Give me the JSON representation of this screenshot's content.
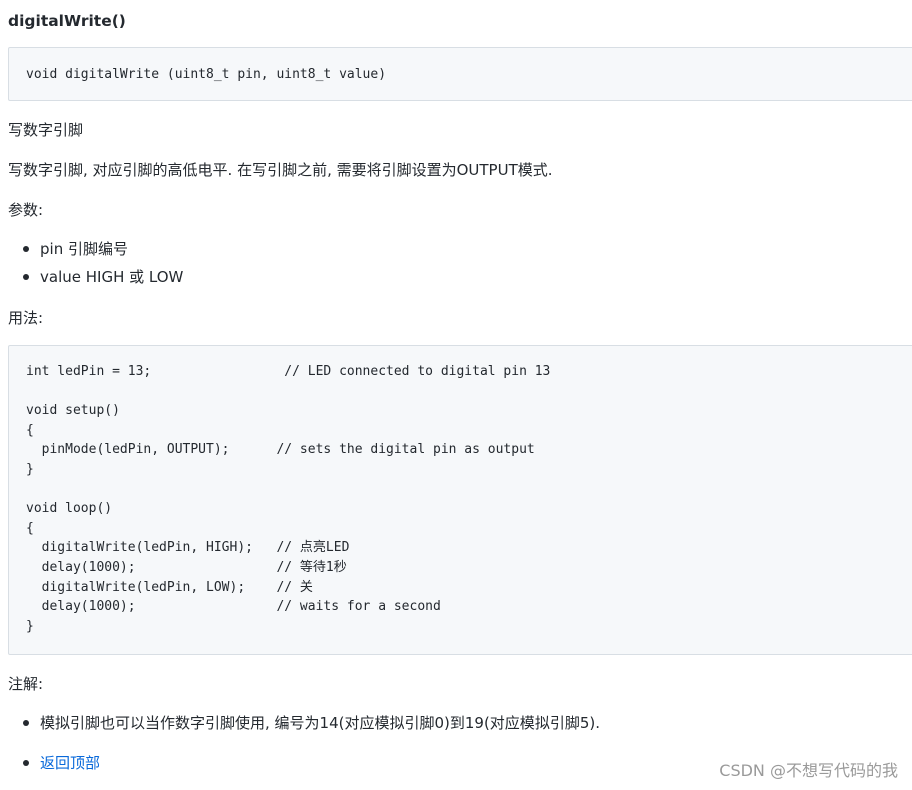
{
  "doc": {
    "title": "digitalWrite()",
    "signature_code": "void digitalWrite (uint8_t pin, uint8_t value)",
    "summary": "写数字引脚",
    "description": "写数字引脚, 对应引脚的高低电平. 在写引脚之前, 需要将引脚设置为OUTPUT模式.",
    "params_heading": "参数:",
    "params": [
      "pin 引脚编号",
      "value HIGH 或 LOW"
    ],
    "usage_heading": "用法:",
    "example_code": "int ledPin = 13;                 // LED connected to digital pin 13\n\nvoid setup()\n{\n  pinMode(ledPin, OUTPUT);      // sets the digital pin as output\n}\n\nvoid loop()\n{\n  digitalWrite(ledPin, HIGH);   // 点亮LED\n  delay(1000);                  // 等待1秒\n  digitalWrite(ledPin, LOW);    // 关\n  delay(1000);                  // waits for a second\n}",
    "notes_heading": "注解:",
    "notes": [
      "模拟引脚也可以当作数字引脚使用, 编号为14(对应模拟引脚0)到19(对应模拟引脚5)."
    ],
    "back_to_top_label": "返回顶部"
  },
  "watermark": "CSDN @不想写代码的我",
  "colors": {
    "link": "#0969da",
    "code_background": "#f6f8fa",
    "text": "#24292f"
  }
}
